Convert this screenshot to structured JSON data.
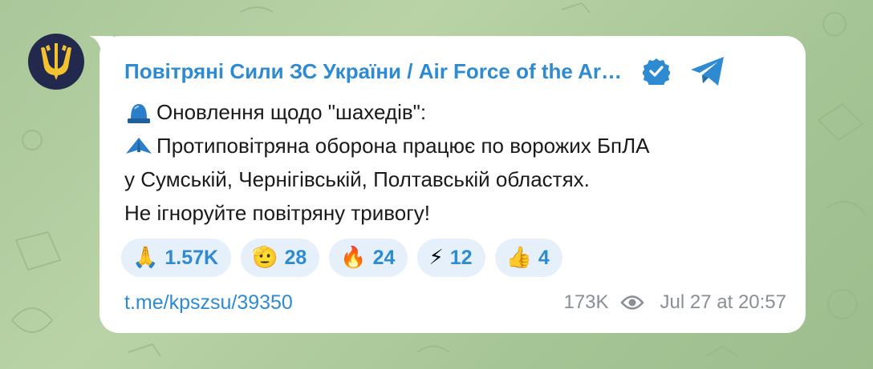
{
  "post": {
    "channel_name": "Повітряні Сили ЗС України / Air Force of the Ar…",
    "lines": [
      {
        "emoji": "siren-emoji",
        "text": "Оновлення щодо \"шахедів\":"
      },
      {
        "emoji": "drone-emoji",
        "text": "Протиповітряна оборона працює по ворожих БпЛА"
      },
      {
        "emoji": "",
        "text": "у Сумській, Чернігівській, Полтавській областях."
      },
      {
        "emoji": "",
        "text": "Не ігноруйте повітряну тривогу!"
      }
    ],
    "reactions": [
      {
        "emoji": "🙏",
        "icon": "folded-hands-emoji",
        "count": "1.57K"
      },
      {
        "emoji": "🫡",
        "icon": "saluting-face-emoji",
        "count": "28"
      },
      {
        "emoji": "🔥",
        "icon": "fire-emoji",
        "count": "24"
      },
      {
        "emoji": "⚡",
        "icon": "lightning-emoji",
        "count": "12"
      },
      {
        "emoji": "👍",
        "icon": "thumbs-up-emoji",
        "count": "4"
      }
    ],
    "link": "t.me/kpszsu/39350",
    "views": "173K",
    "date": "Jul 27 at 20:57"
  },
  "colors": {
    "accent": "#2e8bd1",
    "background": "#b0cd9e",
    "bubble": "#ffffff",
    "reaction_bg": "#e6f0fa",
    "meta": "#8a8f95",
    "avatar_bg": "#23284d",
    "avatar_emblem": "#f2c230"
  },
  "icons": {
    "avatar": "air-force-trident-logo",
    "verified": "verified-badge-icon",
    "telegram": "telegram-plane-icon",
    "views": "eye-icon"
  }
}
